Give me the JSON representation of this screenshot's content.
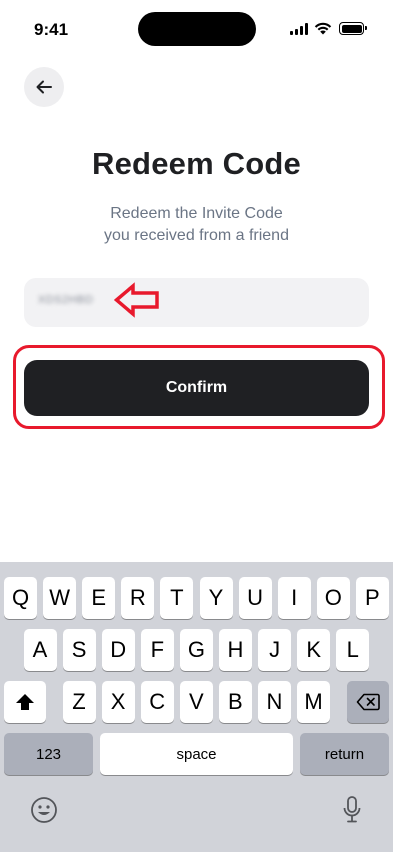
{
  "status_bar": {
    "time": "9:41"
  },
  "header": {
    "back_icon": "arrow-left-icon"
  },
  "main": {
    "title": "Redeem Code",
    "subtitle_line1": "Redeem the Invite Code",
    "subtitle_line2": "you received from a friend",
    "code_input": {
      "value": "XDS2HBD"
    },
    "confirm_label": "Confirm"
  },
  "keyboard": {
    "row1": [
      "Q",
      "W",
      "E",
      "R",
      "T",
      "Y",
      "U",
      "I",
      "O",
      "P"
    ],
    "row2": [
      "A",
      "S",
      "D",
      "F",
      "G",
      "H",
      "J",
      "K",
      "L"
    ],
    "row3": [
      "Z",
      "X",
      "C",
      "V",
      "B",
      "N",
      "M"
    ],
    "numbers_label": "123",
    "space_label": "space",
    "return_label": "return",
    "shift_icon": "shift-icon",
    "delete_icon": "delete-icon",
    "emoji_icon": "emoji-icon",
    "mic_icon": "microphone-icon"
  },
  "colors": {
    "accent_dark": "#1f2023",
    "highlight_red": "#e8192c",
    "keyboard_bg": "#d1d3d9"
  }
}
